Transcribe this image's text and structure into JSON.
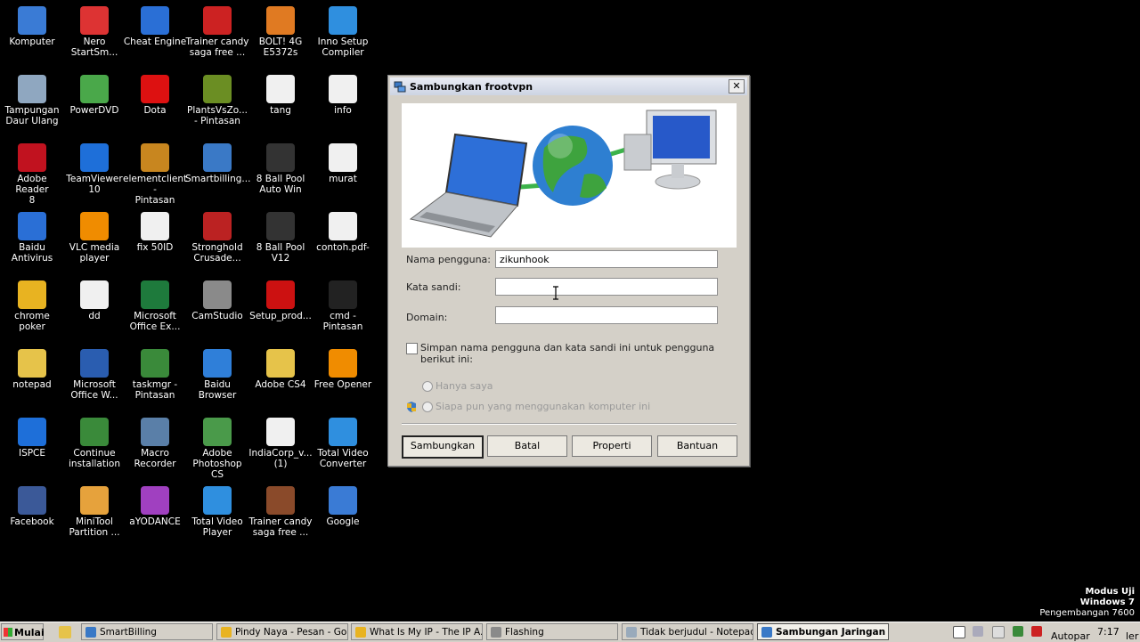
{
  "desktop": {
    "icons": [
      {
        "label": "Komputer",
        "color": "#3a7bd5"
      },
      {
        "label": "Nero\nStartSm...",
        "color": "#d33"
      },
      {
        "label": "Cheat Engine",
        "color": "#2a6fd6"
      },
      {
        "label": "Trainer candy\nsaga free ...",
        "color": "#c22"
      },
      {
        "label": "BOLT! 4G\nE5372s",
        "color": "#e07a22"
      },
      {
        "label": "Inno Setup\nCompiler",
        "color": "#2f8fdf"
      },
      {
        "label": "Tampungan\nDaur Ulang",
        "color": "#8fa7c0"
      },
      {
        "label": "PowerDVD",
        "color": "#4aa84a"
      },
      {
        "label": "Dota",
        "color": "#d11"
      },
      {
        "label": "PlantsVsZo...\n- Pintasan",
        "color": "#6b8e23"
      },
      {
        "label": "tang",
        "color": "#f0f0f0"
      },
      {
        "label": "info",
        "color": "#f0f0f0"
      },
      {
        "label": "Adobe Reader\n8",
        "color": "#c1121f"
      },
      {
        "label": "TeamViewer\n10",
        "color": "#1e6fd9"
      },
      {
        "label": "elementclient -\nPintasan",
        "color": "#c8861f"
      },
      {
        "label": "Smartbilling...",
        "color": "#3a79c6"
      },
      {
        "label": "8 Ball Pool\nAuto Win",
        "color": "#333"
      },
      {
        "label": "murat",
        "color": "#f0f0f0"
      },
      {
        "label": "Baidu Antivirus",
        "color": "#2a6fd6"
      },
      {
        "label": "VLC media\nplayer",
        "color": "#f08c00"
      },
      {
        "label": "fix 50ID",
        "color": "#f0f0f0"
      },
      {
        "label": "Stronghold\nCrusade...",
        "color": "#b22"
      },
      {
        "label": "8 Ball Pool V12",
        "color": "#333"
      },
      {
        "label": "contoh.pdf-",
        "color": "#f0f0f0"
      },
      {
        "label": "chrome poker",
        "color": "#e8b321"
      },
      {
        "label": "dd",
        "color": "#f0f0f0"
      },
      {
        "label": "Microsoft\nOffice Ex...",
        "color": "#1e7a3c"
      },
      {
        "label": "CamStudio",
        "color": "#8a8a8a"
      },
      {
        "label": "Setup_prod...",
        "color": "#c11"
      },
      {
        "label": "cmd - Pintasan",
        "color": "#222"
      },
      {
        "label": "notepad",
        "color": "#e6c34a"
      },
      {
        "label": "Microsoft\nOffice W...",
        "color": "#2a5db0"
      },
      {
        "label": "taskmgr -\nPintasan",
        "color": "#3a8a3a"
      },
      {
        "label": "Baidu Browser",
        "color": "#2f7fd9"
      },
      {
        "label": "Adobe CS4",
        "color": "#e6c34a"
      },
      {
        "label": "Free Opener",
        "color": "#f08c00"
      },
      {
        "label": "ISPCE",
        "color": "#1e6fd9"
      },
      {
        "label": "Continue\ninstallation",
        "color": "#3a8a3a"
      },
      {
        "label": "Macro\nRecorder",
        "color": "#5a7fa8"
      },
      {
        "label": "Adobe\nPhotoshop CS",
        "color": "#4a9a4a"
      },
      {
        "label": "IndiaCorp_v...\n(1)",
        "color": "#f0f0f0"
      },
      {
        "label": "Total Video\nConverter",
        "color": "#2f8fdf"
      },
      {
        "label": "Facebook",
        "color": "#3b5998"
      },
      {
        "label": "MiniTool\nPartition ...",
        "color": "#e6a23c"
      },
      {
        "label": "aYODANCE",
        "color": "#a040c0"
      },
      {
        "label": "Total Video\nPlayer",
        "color": "#2f8fdf"
      },
      {
        "label": "Trainer candy\nsaga free ...",
        "color": "#8a4a2a"
      },
      {
        "label": "Google",
        "color": "#3a7bd5"
      }
    ],
    "watermark": {
      "line1": "Modus Uji",
      "line2": "Windows 7",
      "line3": "Pengembangan 7600"
    }
  },
  "dialog": {
    "title": "Sambungkan frootvpn",
    "close_glyph": "✕",
    "username_label": "Nama pengguna:",
    "username_value": "zikunhook",
    "password_label": "Kata sandi:",
    "password_value": "",
    "domain_label": "Domain:",
    "domain_value": "",
    "save_checkbox_label": "Simpan nama pengguna dan kata sandi ini untuk pengguna berikut ini:",
    "radio_me_only": "Hanya saya",
    "radio_anyone": "Siapa pun yang menggunakan komputer ini",
    "buttons": {
      "connect": "Sambungkan",
      "cancel": "Batal",
      "properties": "Properti",
      "help": "Bantuan"
    }
  },
  "taskbar": {
    "start_label": "Mulai",
    "tasks": [
      {
        "label": "SmartBilling",
        "color": "#3a79c6"
      },
      {
        "label": "Pindy Naya - Pesan - Go...",
        "color": "#e8b321"
      },
      {
        "label": "What Is My IP - The IP A...",
        "color": "#e8b321"
      },
      {
        "label": "Flashing",
        "color": "#8a8a8a"
      },
      {
        "label": "Tidak berjudul - Notepad",
        "color": "#9ab"
      },
      {
        "label": "Sambungan Jaringan",
        "color": "#3a79c6"
      }
    ],
    "tray_text": "Autopar",
    "tray_text2": "ler",
    "clock": "7:17"
  }
}
